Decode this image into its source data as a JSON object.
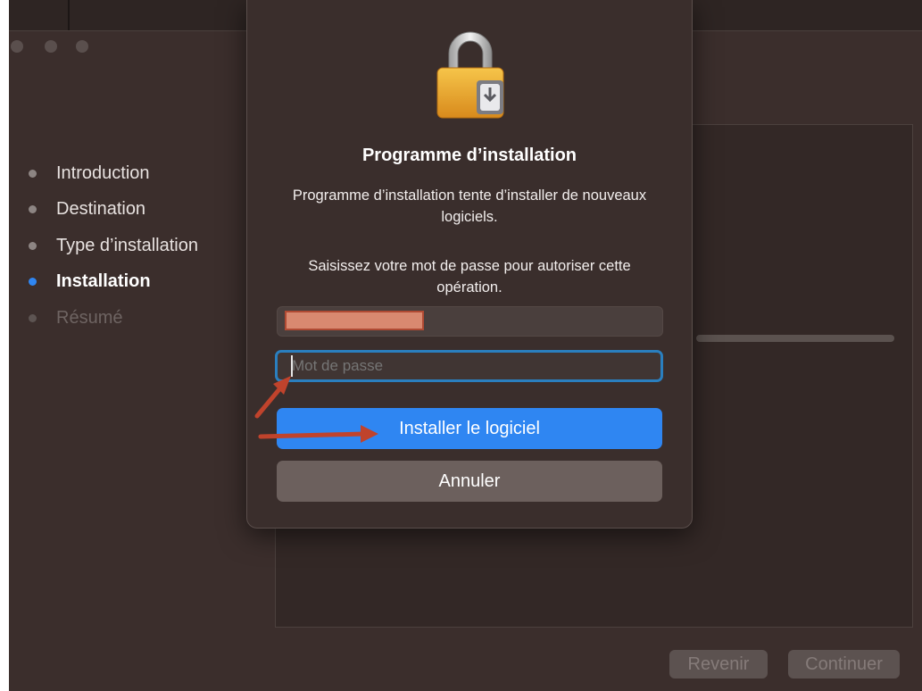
{
  "sidebar": {
    "steps": [
      {
        "label": "Introduction",
        "state": "done"
      },
      {
        "label": "Destination",
        "state": "done"
      },
      {
        "label": "Type d’installation",
        "state": "done"
      },
      {
        "label": "Installation",
        "state": "active"
      },
      {
        "label": "Résumé",
        "state": "pending"
      }
    ]
  },
  "footer": {
    "back_label": "Revenir",
    "continue_label": "Continuer"
  },
  "dialog": {
    "title": "Programme d’installation",
    "message": "Programme d’installation tente d’installer de nouveaux logiciels.",
    "prompt": "Saisissez votre mot de passe pour autoriser cette opération.",
    "password_placeholder": "Mot de passe",
    "password_value": "",
    "install_label": "Installer le logiciel",
    "cancel_label": "Annuler"
  },
  "colors": {
    "accent": "#2f86f2",
    "annotation_arrow": "#c0432c",
    "focus_ring": "#2a7fbf"
  },
  "icons": {
    "dialog_icon": "lock-icon",
    "annotation": "arrow-icon"
  }
}
